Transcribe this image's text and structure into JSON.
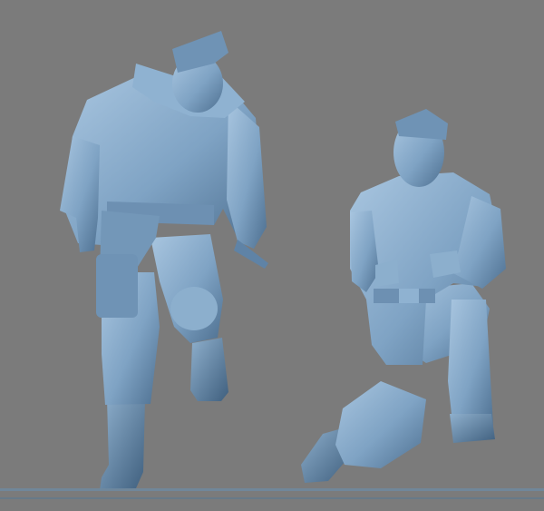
{
  "viewport": {
    "background_color": "#7b7b7b",
    "model_color": "#7fa3c4",
    "model_shadow_color": "#4d6f90",
    "model_highlight_color": "#a9c6e0",
    "grid_line_color": "#6f8aa0"
  },
  "scene": {
    "figures": [
      {
        "id": "walking-soldier",
        "description_icon": "standing-figure-icon"
      },
      {
        "id": "kneeling-soldier",
        "description_icon": "kneeling-figure-icon"
      }
    ]
  }
}
